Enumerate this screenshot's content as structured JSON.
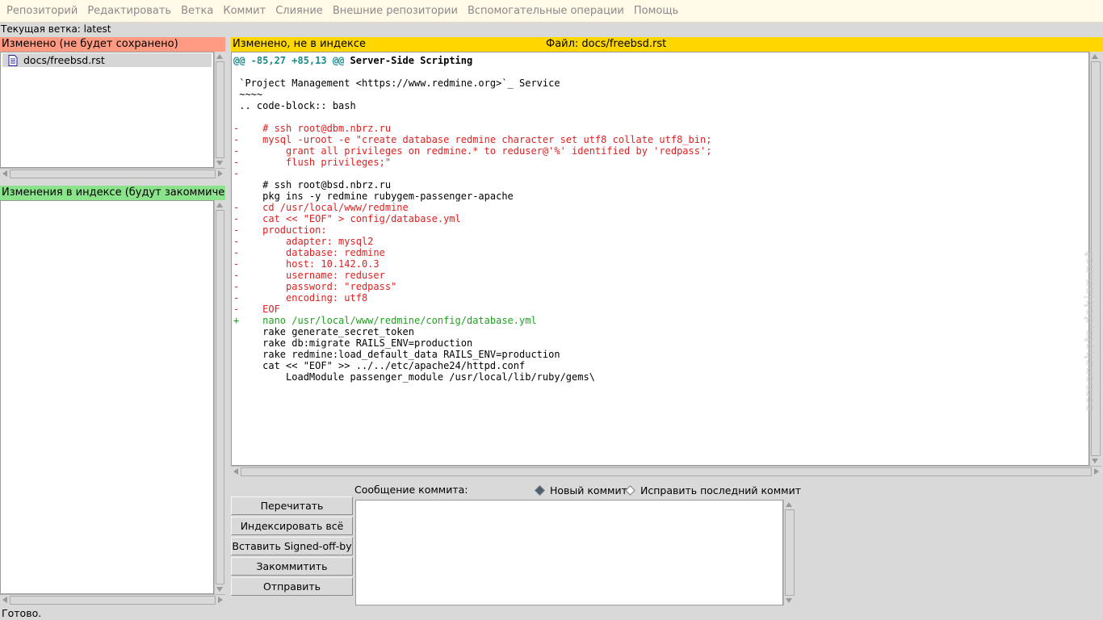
{
  "menubar": {
    "items": [
      "Репозиторий",
      "Редактировать",
      "Ветка",
      "Коммит",
      "Слияние",
      "Внешние репозитории",
      "Вспомогательные операции",
      "Помощь"
    ]
  },
  "branch": {
    "label": "Текущая ветка:",
    "value": "latest"
  },
  "unstaged": {
    "header": "Изменено (не будет сохранено)",
    "files": [
      "docs/freebsd.rst"
    ]
  },
  "staged": {
    "header": "Изменения в индексе (будут закоммичены)"
  },
  "diff": {
    "status": "Изменено, не в индексе",
    "file": "Файл: docs/freebsd.rst",
    "hunk_range": "@@ -85,27 +85,13 @@",
    "hunk_title": "Server-Side Scripting",
    "lines": [
      {
        "type": "ctx",
        "text": ""
      },
      {
        "type": "ctx",
        "text": " `Project Management <https://www.redmine.org>`_ Service"
      },
      {
        "type": "ctx",
        "text": " ~~~~"
      },
      {
        "type": "ctx",
        "text": " .. code-block:: bash"
      },
      {
        "type": "ctx",
        "text": ""
      },
      {
        "type": "del",
        "text": "-    # ssh root@dbm.nbrz.ru"
      },
      {
        "type": "del",
        "text": "-    mysql -uroot -e \"create database redmine character set utf8 collate utf8_bin;"
      },
      {
        "type": "del",
        "text": "-        grant all privileges on redmine.* to reduser@'%' identified by 'redpass';"
      },
      {
        "type": "del",
        "text": "-        flush privileges;\""
      },
      {
        "type": "del",
        "text": "-"
      },
      {
        "type": "ctx",
        "text": "     # ssh root@bsd.nbrz.ru"
      },
      {
        "type": "ctx",
        "text": "     pkg ins -y redmine rubygem-passenger-apache"
      },
      {
        "type": "del",
        "text": "-    cd /usr/local/www/redmine"
      },
      {
        "type": "del",
        "text": "-    cat << \"EOF\" > config/database.yml"
      },
      {
        "type": "del",
        "text": "-    production:"
      },
      {
        "type": "del",
        "text": "-        adapter: mysql2"
      },
      {
        "type": "del",
        "text": "-        database: redmine"
      },
      {
        "type": "del",
        "text": "-        host: 10.142.0.3"
      },
      {
        "type": "del",
        "text": "-        username: reduser"
      },
      {
        "type": "del",
        "text": "-        password: \"redpass\""
      },
      {
        "type": "del",
        "text": "-        encoding: utf8"
      },
      {
        "type": "del",
        "text": "-    EOF"
      },
      {
        "type": "add",
        "text": "+    nano /usr/local/www/redmine/config/database.yml"
      },
      {
        "type": "ctx",
        "text": "     rake generate_secret_token"
      },
      {
        "type": "ctx",
        "text": "     rake db:migrate RAILS_ENV=production"
      },
      {
        "type": "ctx",
        "text": "     rake redmine:load_default_data RAILS_ENV=production"
      },
      {
        "type": "ctx",
        "text": "     cat << \"EOF\" >> ../../etc/apache24/httpd.conf"
      },
      {
        "type": "ctx",
        "text": "         LoadModule passenger_module /usr/local/lib/ruby/gems\\"
      }
    ]
  },
  "commit": {
    "message_label": "Сообщение коммита:",
    "radio_new": "Новый коммит",
    "radio_amend": "Исправить последний коммит",
    "message_value": ""
  },
  "buttons": {
    "rescan": "Перечитать",
    "stage_all": "Индексировать всё",
    "signoff": "Вставить Signed-off-by",
    "commit": "Закоммитить",
    "push": "Отправить"
  },
  "status": "Готово.",
  "watermark": "screenshots.debian.net",
  "colors": {
    "unstaged_header": "#ff9b82",
    "staged_header": "#8be38b",
    "diff_header": "#ffd700",
    "deleted": "#e02020",
    "added": "#20a020",
    "hunk": "#1a8a8a"
  }
}
